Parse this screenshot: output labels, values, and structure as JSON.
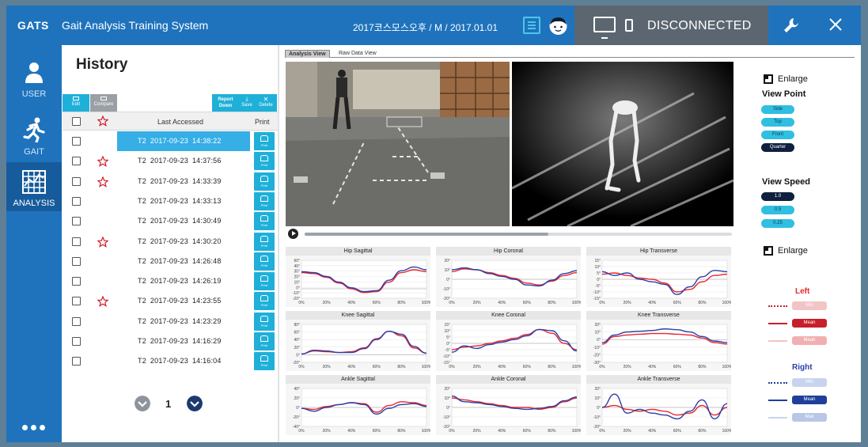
{
  "app": {
    "name": "GATS",
    "title": "Gait Analysis Training System",
    "patient_info": "2017코스모스오후 / M / 2017.01.01",
    "connection_status": "DISCONNECTED"
  },
  "nav": {
    "items": [
      {
        "label": "USER",
        "icon": "user-icon"
      },
      {
        "label": "GAIT",
        "icon": "running-icon"
      },
      {
        "label": "ANALYSIS",
        "icon": "grid-chart-icon",
        "active": true
      }
    ]
  },
  "history": {
    "title": "History",
    "toolbar": {
      "edit": "Edit",
      "compare": "Compare",
      "report_down": "Report Down",
      "save": "Save",
      "delete": "Delete"
    },
    "columns": {
      "last_accessed": "Last Accessed",
      "print": "Print"
    },
    "print_label": "Print",
    "rows": [
      {
        "tag": "T2",
        "date": "2017-09-23",
        "time": "14:38:22",
        "starred": false,
        "selected": true
      },
      {
        "tag": "T2",
        "date": "2017-09-23",
        "time": "14:37:56",
        "starred": true,
        "selected": false
      },
      {
        "tag": "T2",
        "date": "2017-09-23",
        "time": "14:33:39",
        "starred": true,
        "selected": false
      },
      {
        "tag": "T2",
        "date": "2017-09-23",
        "time": "14:33:13",
        "starred": false,
        "selected": false
      },
      {
        "tag": "T2",
        "date": "2017-09-23",
        "time": "14:30:49",
        "starred": false,
        "selected": false
      },
      {
        "tag": "T2",
        "date": "2017-09-23",
        "time": "14:30:20",
        "starred": true,
        "selected": false
      },
      {
        "tag": "T2",
        "date": "2017-09-23",
        "time": "14:26:48",
        "starred": false,
        "selected": false
      },
      {
        "tag": "T2",
        "date": "2017-09-23",
        "time": "14:26:19",
        "starred": false,
        "selected": false
      },
      {
        "tag": "T2",
        "date": "2017-09-23",
        "time": "14:23:55",
        "starred": true,
        "selected": false
      },
      {
        "tag": "T2",
        "date": "2017-09-23",
        "time": "14:23:29",
        "starred": false,
        "selected": false
      },
      {
        "tag": "T2",
        "date": "2017-09-23",
        "time": "14:16:29",
        "starred": false,
        "selected": false
      },
      {
        "tag": "T2",
        "date": "2017-09-23",
        "time": "14:16:04",
        "starred": false,
        "selected": false
      }
    ],
    "pager": {
      "current_page": "1"
    }
  },
  "analysis": {
    "tabs": [
      {
        "label": "Analysis View",
        "active": true
      },
      {
        "label": "Raw Data View",
        "active": false
      }
    ],
    "video_progress": 0.57,
    "x_ticks": [
      "0%",
      "20%",
      "40%",
      "60%",
      "80%",
      "100%"
    ]
  },
  "chart_data": [
    {
      "type": "line",
      "title": "Hip Sagittal",
      "y_ticks": [
        "60°",
        "40°",
        "30°",
        "20°",
        "10°",
        "0°",
        "-10°",
        "-20°"
      ],
      "ylim": [
        -20,
        60
      ],
      "x": [
        0,
        10,
        20,
        30,
        40,
        50,
        60,
        70,
        80,
        90,
        100
      ],
      "series": [
        {
          "color": "#e8262d",
          "values": [
            34,
            32,
            24,
            12,
            0,
            -8,
            -6,
            14,
            34,
            40,
            36
          ]
        },
        {
          "color": "#2b3fa8",
          "values": [
            36,
            34,
            26,
            14,
            2,
            -6,
            -4,
            18,
            38,
            46,
            40
          ]
        }
      ]
    },
    {
      "type": "line",
      "title": "Hip Coronal",
      "y_ticks": [
        "20°",
        "10°",
        "0°",
        "-10°",
        "-20°"
      ],
      "ylim": [
        -20,
        20
      ],
      "x": [
        0,
        10,
        20,
        30,
        40,
        50,
        60,
        70,
        80,
        90,
        100
      ],
      "series": [
        {
          "color": "#e8262d",
          "values": [
            8,
            11,
            10,
            7,
            4,
            1,
            -4,
            -6,
            -2,
            4,
            7
          ]
        },
        {
          "color": "#2b3fa8",
          "values": [
            10,
            12,
            10,
            6,
            3,
            0,
            -6,
            -7,
            -1,
            6,
            9
          ]
        }
      ]
    },
    {
      "type": "line",
      "title": "Hip Transverse",
      "y_ticks": [
        "15°",
        "10°",
        "5°",
        "0°",
        "-5°",
        "-10°",
        "-15°"
      ],
      "ylim": [
        -15,
        15
      ],
      "x": [
        0,
        10,
        20,
        30,
        40,
        50,
        60,
        70,
        80,
        90,
        100
      ],
      "series": [
        {
          "color": "#e8262d",
          "values": [
            4,
            5,
            3,
            1,
            0,
            -3,
            -10,
            -8,
            -2,
            3,
            4
          ]
        },
        {
          "color": "#2b3fa8",
          "values": [
            6,
            3,
            5,
            0,
            -2,
            -4,
            -12,
            -6,
            2,
            7,
            6
          ]
        }
      ]
    },
    {
      "type": "line",
      "title": "Knee Sagittal",
      "y_ticks": [
        "80°",
        "60°",
        "40°",
        "20°",
        "0°",
        "-20°"
      ],
      "ylim": [
        -20,
        80
      ],
      "x": [
        0,
        10,
        20,
        30,
        40,
        50,
        60,
        70,
        80,
        90,
        100
      ],
      "series": [
        {
          "color": "#e8262d",
          "values": [
            2,
            10,
            8,
            6,
            8,
            18,
            42,
            62,
            50,
            18,
            4
          ]
        },
        {
          "color": "#2b3fa8",
          "values": [
            2,
            12,
            10,
            6,
            6,
            16,
            40,
            62,
            54,
            22,
            4
          ]
        }
      ]
    },
    {
      "type": "line",
      "title": "Knee Coronal",
      "y_ticks": [
        "15°",
        "10°",
        "5°",
        "0°",
        "-5°",
        "-10°",
        "-15°"
      ],
      "ylim": [
        -15,
        15
      ],
      "x": [
        0,
        10,
        20,
        30,
        40,
        50,
        60,
        70,
        80,
        90,
        100
      ],
      "series": [
        {
          "color": "#e8262d",
          "values": [
            -5,
            -3,
            -2,
            0,
            2,
            4,
            7,
            11,
            8,
            0,
            -5
          ]
        },
        {
          "color": "#2b3fa8",
          "values": [
            -7,
            -2,
            -4,
            -1,
            1,
            3,
            6,
            11,
            10,
            2,
            -6
          ]
        }
      ]
    },
    {
      "type": "line",
      "title": "Knee Transverse",
      "y_ticks": [
        "20°",
        "10°",
        "0°",
        "-10°",
        "-20°",
        "-30°"
      ],
      "ylim": [
        -30,
        20
      ],
      "x": [
        0,
        10,
        20,
        30,
        40,
        50,
        60,
        70,
        80,
        90,
        100
      ],
      "series": [
        {
          "color": "#e8262d",
          "values": [
            -6,
            4,
            6,
            7,
            8,
            8,
            7,
            6,
            2,
            -4,
            -6
          ]
        },
        {
          "color": "#2b3fa8",
          "values": [
            -4,
            6,
            10,
            11,
            12,
            14,
            13,
            10,
            4,
            -2,
            -4
          ]
        }
      ]
    },
    {
      "type": "line",
      "title": "Ankle Sagittal",
      "y_ticks": [
        "40°",
        "20°",
        "0°",
        "-20°",
        "-40°"
      ],
      "ylim": [
        -40,
        40
      ],
      "x": [
        0,
        10,
        20,
        30,
        40,
        50,
        60,
        70,
        80,
        90,
        100
      ],
      "series": [
        {
          "color": "#e8262d",
          "values": [
            -2,
            -4,
            2,
            6,
            10,
            8,
            -10,
            4,
            12,
            10,
            4
          ]
        },
        {
          "color": "#2b3fa8",
          "values": [
            -2,
            -8,
            0,
            6,
            10,
            6,
            -14,
            -2,
            6,
            8,
            2
          ]
        }
      ]
    },
    {
      "type": "line",
      "title": "Ankle Coronal",
      "y_ticks": [
        "20°",
        "10°",
        "0°",
        "-10°",
        "-20°"
      ],
      "ylim": [
        -20,
        20
      ],
      "x": [
        0,
        10,
        20,
        30,
        40,
        50,
        60,
        70,
        80,
        90,
        100
      ],
      "series": [
        {
          "color": "#e8262d",
          "values": [
            10,
            8,
            6,
            4,
            2,
            0,
            0,
            -2,
            0,
            6,
            10
          ]
        },
        {
          "color": "#2b3fa8",
          "values": [
            12,
            6,
            5,
            3,
            1,
            -1,
            -2,
            -1,
            1,
            7,
            11
          ]
        }
      ]
    },
    {
      "type": "line",
      "title": "Ankle Transverse",
      "y_ticks": [
        "20°",
        "10°",
        "0°",
        "-10°",
        "-20°"
      ],
      "ylim": [
        -20,
        20
      ],
      "x": [
        0,
        10,
        20,
        30,
        40,
        50,
        60,
        70,
        80,
        90,
        100
      ],
      "series": [
        {
          "color": "#e8262d",
          "values": [
            0,
            2,
            -2,
            -4,
            -2,
            -4,
            -8,
            -6,
            2,
            -8,
            0
          ]
        },
        {
          "color": "#2b3fa8",
          "values": [
            0,
            14,
            -6,
            -2,
            -6,
            -8,
            -12,
            -4,
            8,
            -12,
            4
          ]
        }
      ]
    }
  ],
  "controls": {
    "enlarge": "Enlarge",
    "view_point": {
      "label": "View Point",
      "options": [
        "Side",
        "Top",
        "Front",
        "Quarter"
      ],
      "selected": "Quarter"
    },
    "view_speed": {
      "label": "View Speed",
      "options": [
        "1.0",
        "0.5",
        "0.25"
      ],
      "selected": "1.0"
    },
    "legend": {
      "left": {
        "label": "Left",
        "color": "#e8262d",
        "items": [
          "Min",
          "Mean",
          "Mean"
        ]
      },
      "right": {
        "label": "Right",
        "color": "#2b3fa8",
        "items": [
          "Min",
          "Mean",
          "Max"
        ]
      }
    }
  },
  "colors": {
    "brand": "#1f73bd",
    "accent": "#36aee6",
    "star": "#d01c2a"
  }
}
